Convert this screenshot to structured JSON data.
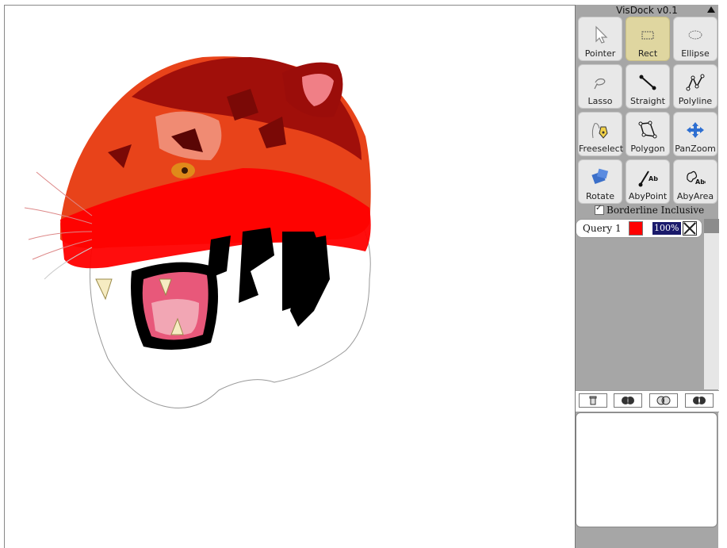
{
  "dock": {
    "title": "VisDock v0.1",
    "tools": [
      {
        "label": "Pointer",
        "icon": "pointer-icon"
      },
      {
        "label": "Rect",
        "icon": "rect-icon",
        "active": true
      },
      {
        "label": "Ellipse",
        "icon": "ellipse-icon"
      },
      {
        "label": "Lasso",
        "icon": "lasso-icon"
      },
      {
        "label": "Straight",
        "icon": "straight-icon"
      },
      {
        "label": "Polyline",
        "icon": "polyline-icon"
      },
      {
        "label": "Freeselect",
        "icon": "freeselect-icon"
      },
      {
        "label": "Polygon",
        "icon": "polygon-icon"
      },
      {
        "label": "PanZoom",
        "icon": "panzoom-icon"
      },
      {
        "label": "Rotate",
        "icon": "rotate-icon"
      },
      {
        "label": "AbyPoint",
        "icon": "abypoint-icon"
      },
      {
        "label": "AbyArea",
        "icon": "abyarea-icon"
      }
    ],
    "borderline_label": "Borderline Inclusive",
    "borderline_checked": true,
    "queries": [
      {
        "label": "Query 1",
        "color": "#ff0000",
        "opacity": "100%"
      }
    ],
    "set_ops": [
      "delete-icon",
      "intersect-icon",
      "union-icon",
      "xor-icon"
    ]
  },
  "canvas": {
    "subject": "tiger-head-illustration",
    "highlight_color": "#ff0000"
  }
}
